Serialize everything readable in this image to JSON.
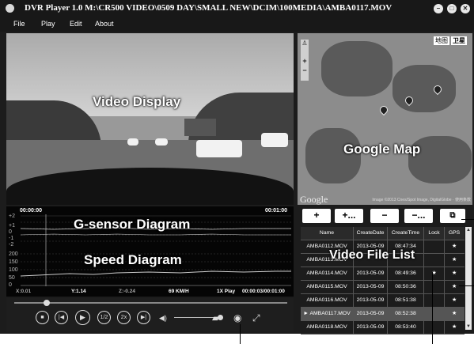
{
  "app": {
    "title": "DVR Player 1.0   M:\\CR500 VIDEO\\0509 DAY\\SMALL NEW\\DCIM\\100MEDIA\\AMBA0117.MOV",
    "window_buttons": [
      "minimize-icon",
      "maximize-icon",
      "close-icon"
    ]
  },
  "menu": {
    "items": [
      "File",
      "Play",
      "Edit",
      "About"
    ]
  },
  "video": {
    "callout": "Video Display"
  },
  "map": {
    "callout": "Google Map",
    "type_buttons": [
      "地图",
      "卫星"
    ],
    "logo": "Google",
    "copyright": "Image ©2013 Cnes/Spot Image, DigitalGlobe · 使用条款"
  },
  "gsensor": {
    "time_start": "00:00:00",
    "time_end": "00:01:00",
    "g_labels": [
      "+2",
      "+1",
      "0",
      "-1",
      "-2"
    ],
    "speed_labels": [
      "200",
      "150",
      "100",
      "50",
      "0"
    ],
    "callout_g": "G-sensor Diagram",
    "callout_speed": "Speed Diagram",
    "status": {
      "x": "X:0.01",
      "y": "Y:1.14",
      "z": "Z:-0.24",
      "speed": "69 KM/H",
      "play": "1X Play",
      "time": "00:00:03/00:01:00"
    }
  },
  "controls": {
    "stop_icon": "stop-icon",
    "prev_icon": "previous-icon",
    "play_icon": "play-icon",
    "half_speed": "1/2",
    "double_speed": "2x",
    "next_icon": "next-icon",
    "volume_icon": "volume-icon",
    "folder_icon": "folder-icon",
    "snapshot_icon": "camera-icon",
    "fullscreen_icon": "fullscreen-icon"
  },
  "file_list": {
    "callout": "Video File List",
    "buttons": [
      "+",
      "+...",
      "−",
      "−...",
      "copy-icon"
    ],
    "columns": [
      "Name",
      "CreateDate",
      "CreateTime",
      "Lock",
      "GPS"
    ],
    "rows": [
      {
        "name": "AMBA0112.MOV",
        "date": "2013-05-09",
        "time": "08:47:34",
        "lock": "",
        "gps": "★"
      },
      {
        "name": "AMBA0113.MOV",
        "date": "",
        "time": "",
        "lock": "",
        "gps": "★"
      },
      {
        "name": "AMBA0114.MOV",
        "date": "2013-05-09",
        "time": "08:49:36",
        "lock": "★",
        "gps": "★"
      },
      {
        "name": "AMBA0115.MOV",
        "date": "2013-05-09",
        "time": "08:50:36",
        "lock": "",
        "gps": "★"
      },
      {
        "name": "AMBA0116.MOV",
        "date": "2013-05-09",
        "time": "08:51:38",
        "lock": "",
        "gps": "★"
      },
      {
        "name": "► AMBA0117.MOV",
        "date": "2013-05-09",
        "time": "08:52:38",
        "lock": "",
        "gps": "★"
      },
      {
        "name": "AMBA0118.MOV",
        "date": "2013-05-09",
        "time": "08:53:40",
        "lock": "",
        "gps": "★"
      }
    ],
    "selected_index": 5
  }
}
